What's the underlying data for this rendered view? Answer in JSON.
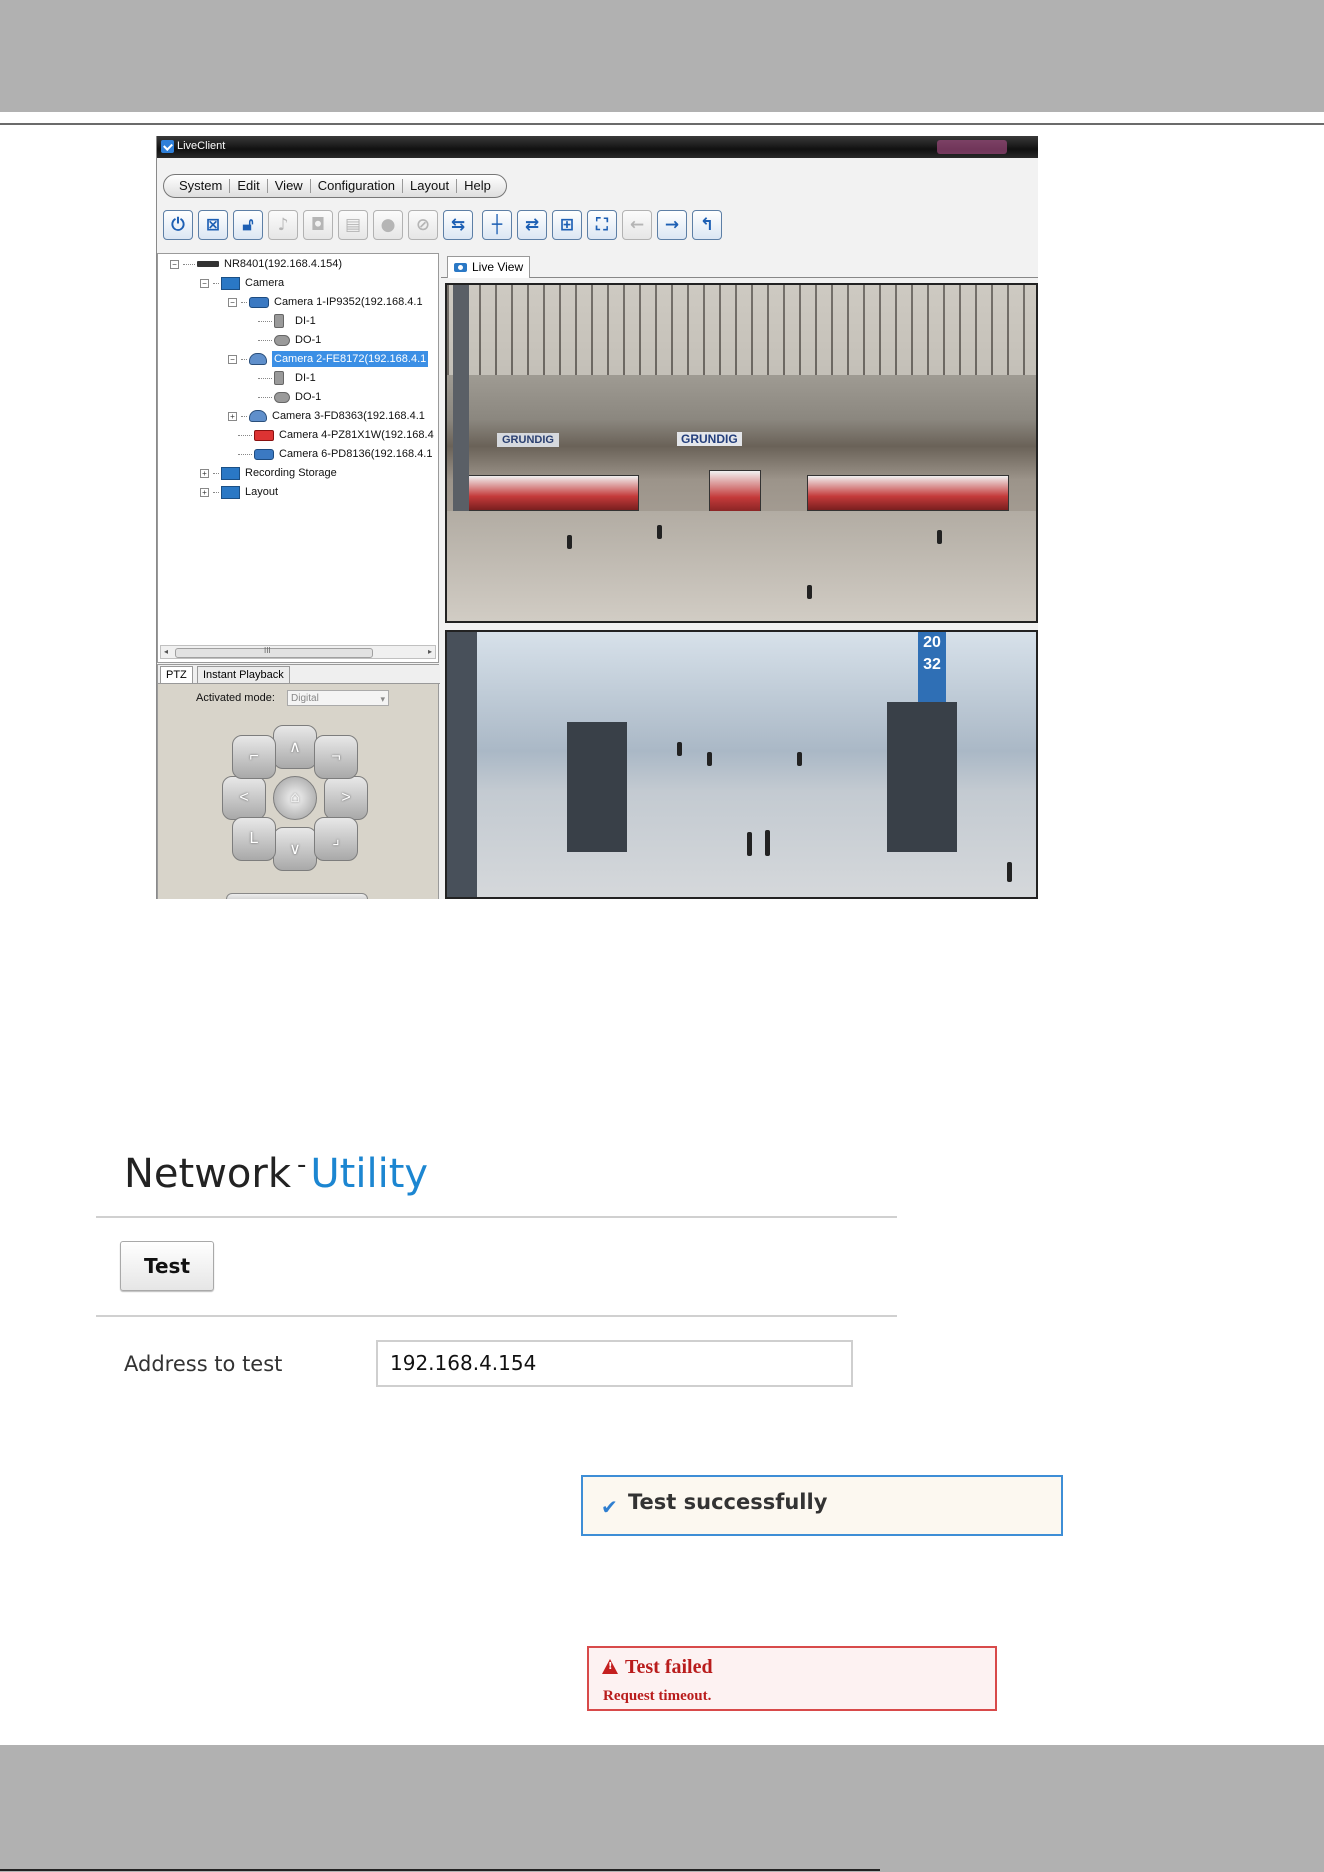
{
  "liveclient": {
    "title": "LiveClient",
    "menu": [
      "System",
      "Edit",
      "View",
      "Configuration",
      "Layout",
      "Help"
    ],
    "toolbar_icons": [
      "power-icon",
      "disconnect-icon",
      "lock-icon",
      "speaker-icon",
      "snapshot-icon",
      "print-icon",
      "record-icon",
      "stop-icon",
      "export-icon",
      "grid-snap-icon",
      "swap-icon",
      "layout-grid-icon",
      "fullscreen-icon",
      "back-arrow-icon",
      "forward-arrow-icon",
      "return-icon"
    ],
    "tree": {
      "nvr": "NR8401(192.168.4.154)",
      "camera_group": "Camera",
      "cam1": "Camera 1-IP9352(192.168.4.1",
      "cam1_di": "DI-1",
      "cam1_do": "DO-1",
      "cam2": "Camera 2-FE8172(192.168.4.1",
      "cam2_di": "DI-1",
      "cam2_do": "DO-1",
      "cam3": "Camera 3-FD8363(192.168.4.1",
      "cam4": "Camera 4-PZ81X1W(192.168.4",
      "cam6": "Camera 6-PD8136(192.168.4.1",
      "recording": "Recording Storage",
      "layout": "Layout",
      "scroll_mark": "III"
    },
    "ptz": {
      "tab_ptz": "PTZ",
      "tab_playback": "Instant Playback",
      "mode_label": "Activated mode:",
      "mode_value": "Digital"
    },
    "live_view_tab": "Live View",
    "video1_sign_left": "GRUNDIG",
    "video1_sign_center": "GRUNDIG",
    "video2_panel": "20\n32"
  },
  "network_utility": {
    "title_main": "Network",
    "title_dash": "-",
    "title_sub": "Utility",
    "test_button": "Test",
    "address_label": "Address to test",
    "address_value": "192.168.4.154",
    "success_message": "Test successfully",
    "fail_title": "Test failed",
    "fail_detail": "Request timeout."
  },
  "colors": {
    "accent_blue": "#1c86d1",
    "success_border": "#3e8ed6",
    "error_red": "#b91c1c",
    "band_gray": "#b1b1b1"
  }
}
